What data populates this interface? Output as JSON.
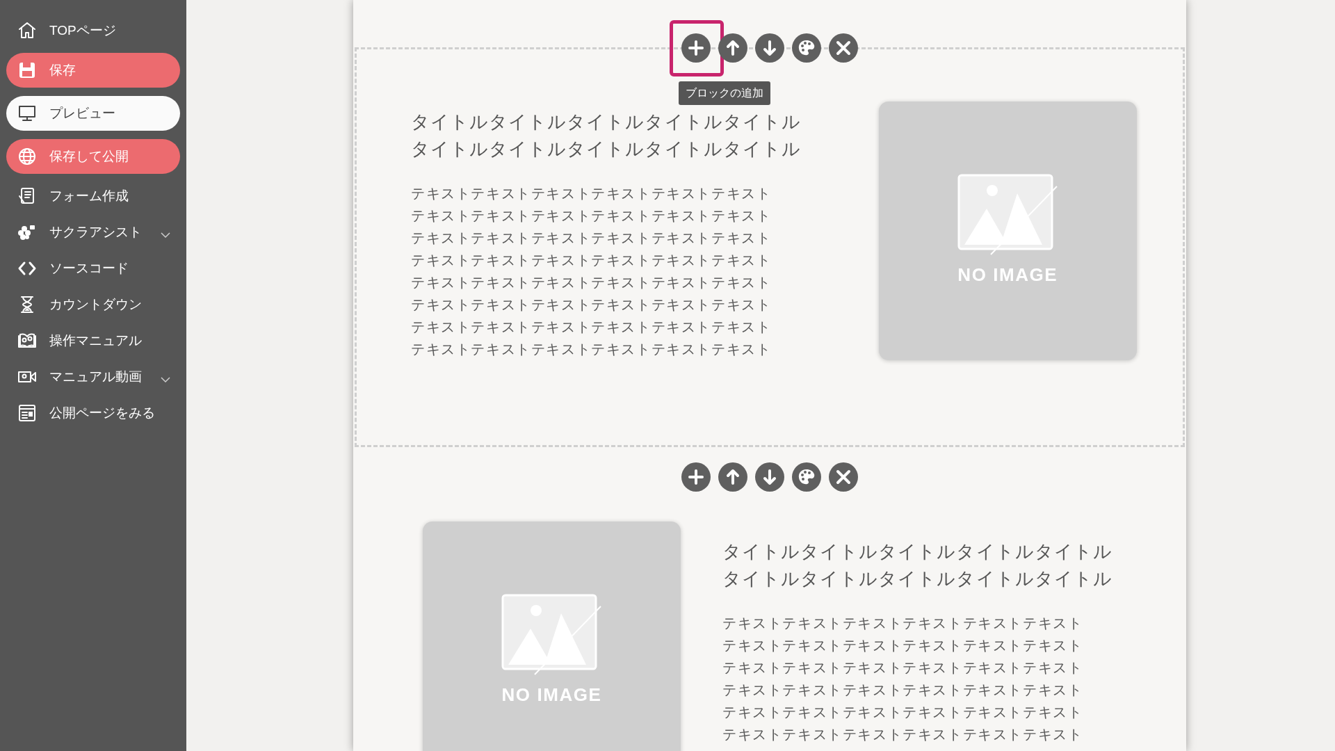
{
  "sidebar": {
    "items": [
      {
        "kind": "link",
        "label": "TOPページ",
        "expandable": false
      },
      {
        "kind": "accent",
        "label": "保存",
        "expandable": false
      },
      {
        "kind": "plain",
        "label": "プレビュー",
        "expandable": false
      },
      {
        "kind": "accent",
        "label": "保存して公開",
        "expandable": false
      },
      {
        "kind": "link",
        "label": "フォーム作成",
        "expandable": false
      },
      {
        "kind": "link",
        "label": "サクラアシスト",
        "expandable": true
      },
      {
        "kind": "link",
        "label": "ソースコード",
        "expandable": false
      },
      {
        "kind": "link",
        "label": "カウントダウン",
        "expandable": false
      },
      {
        "kind": "link",
        "label": "操作マニュアル",
        "expandable": false
      },
      {
        "kind": "link",
        "label": "マニュアル動画",
        "expandable": true
      },
      {
        "kind": "link",
        "label": "公開ページをみる",
        "expandable": false
      }
    ]
  },
  "blocks": [
    {
      "kind": "image-right",
      "selected": true,
      "toolbar": [
        {
          "kind": "add",
          "highlighted": true,
          "tooltip": "ブロックの追加"
        },
        {
          "kind": "up",
          "highlighted": false
        },
        {
          "kind": "down",
          "highlighted": false
        },
        {
          "kind": "palette",
          "highlighted": false
        },
        {
          "kind": "delete",
          "highlighted": false
        }
      ],
      "title": [
        "タイトルタイトルタイトルタイトルタイトル",
        "タイトルタイトルタイトルタイトルタイトル"
      ],
      "body": [
        "テキストテキストテキストテキストテキストテキスト",
        "テキストテキストテキストテキストテキストテキスト",
        "テキストテキストテキストテキストテキストテキスト",
        "テキストテキストテキストテキストテキストテキスト",
        "テキストテキストテキストテキストテキストテキスト",
        "テキストテキストテキストテキストテキストテキスト",
        "テキストテキストテキストテキストテキストテキスト",
        "テキストテキストテキストテキストテキストテキスト"
      ],
      "image_text": "NO IMAGE"
    },
    {
      "kind": "image-left",
      "selected": false,
      "toolbar": [
        {
          "kind": "add",
          "highlighted": false
        },
        {
          "kind": "up",
          "highlighted": false
        },
        {
          "kind": "down",
          "highlighted": false
        },
        {
          "kind": "palette",
          "highlighted": false
        },
        {
          "kind": "delete",
          "highlighted": false
        }
      ],
      "title": [
        "タイトルタイトルタイトルタイトルタイトル",
        "タイトルタイトルタイトルタイトルタイトル"
      ],
      "body": [
        "テキストテキストテキストテキストテキストテキスト",
        "テキストテキストテキストテキストテキストテキスト",
        "テキストテキストテキストテキストテキストテキスト",
        "テキストテキストテキストテキストテキストテキスト",
        "テキストテキストテキストテキストテキストテキスト",
        "テキストテキストテキストテキストテキストテキスト"
      ],
      "image_text": "NO IMAGE"
    }
  ]
}
